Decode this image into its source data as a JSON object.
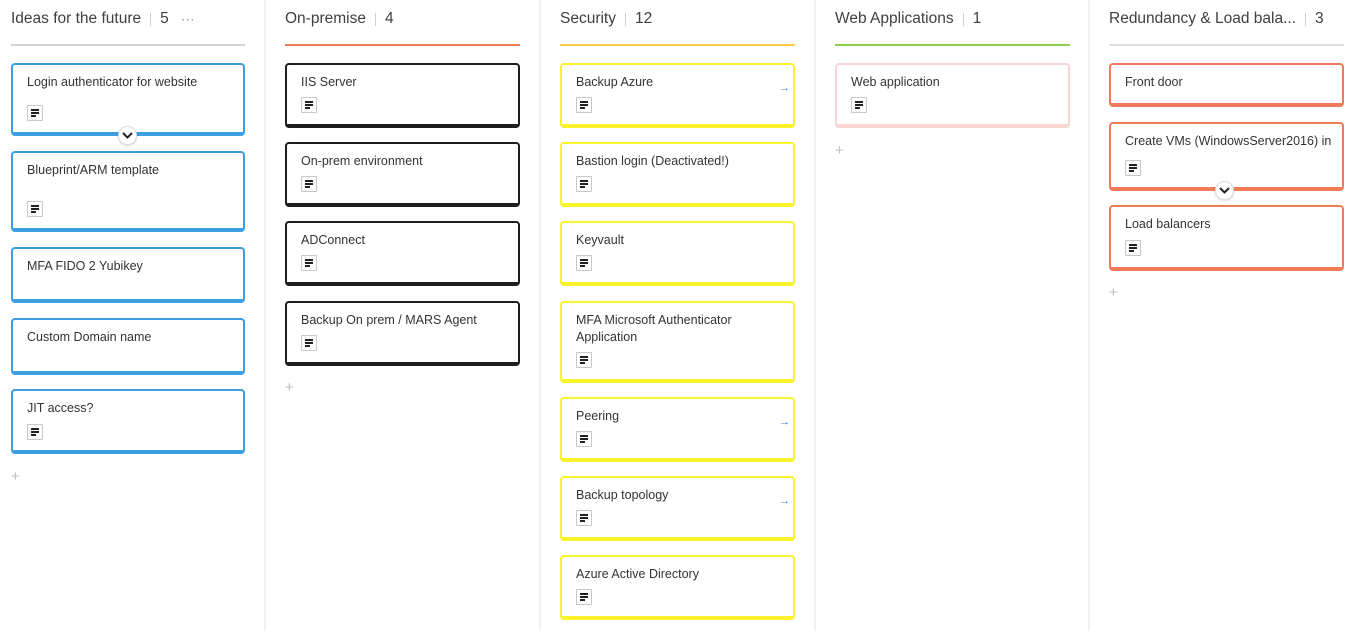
{
  "columns": [
    {
      "title": "Ideas for the future",
      "count": "5",
      "more": "⋯",
      "accent": "#3b9ee0",
      "cards": [
        {
          "title": "Login authenticator for website",
          "has_note": true,
          "has_expand": true,
          "has_link": false
        },
        {
          "title": "Blueprint/ARM template",
          "has_note": true,
          "has_expand": false,
          "has_link": false
        },
        {
          "title": "MFA FIDO 2 Yubikey",
          "has_note": false,
          "has_expand": false,
          "has_link": false
        },
        {
          "title": "Custom Domain name",
          "has_note": false,
          "has_expand": false,
          "has_link": false
        },
        {
          "title": "JIT access?",
          "has_note": true,
          "has_expand": false,
          "has_link": false
        }
      ],
      "add_label": "+"
    },
    {
      "title": "On-premise",
      "count": "4",
      "accent": "#f07b58",
      "card_border": "#1e1e1e",
      "cards": [
        {
          "title": "IIS Server",
          "has_note": true
        },
        {
          "title": "On-prem environment",
          "has_note": true
        },
        {
          "title": "ADConnect",
          "has_note": true
        },
        {
          "title": "Backup On prem / MARS Agent",
          "has_note": true
        }
      ],
      "add_label": "+"
    },
    {
      "title": "Security",
      "count": "12",
      "accent": "#f5cc3f",
      "card_border": "#f8f32b",
      "cards": [
        {
          "title": "Backup Azure",
          "has_note": true,
          "has_link": true
        },
        {
          "title": "Bastion login (Deactivated!)",
          "has_note": true,
          "has_link": false
        },
        {
          "title": "Keyvault",
          "has_note": true,
          "has_link": false
        },
        {
          "title": "MFA Microsoft Authenticator Application",
          "has_note": true,
          "has_link": false
        },
        {
          "title": "Peering",
          "has_note": true,
          "has_link": true
        },
        {
          "title": "Backup topology",
          "has_note": true,
          "has_link": true
        },
        {
          "title": "Azure Active Directory",
          "has_note": true,
          "has_link": false
        }
      ]
    },
    {
      "title": "Web Applications",
      "count": "1",
      "accent": "#8fd14f",
      "card_border": "#f6d5d3",
      "cards": [
        {
          "title": "Web application",
          "has_note": true
        }
      ],
      "add_label": "+"
    },
    {
      "title": "Redundancy & Load bala...",
      "count": "3",
      "accent": "#e0e0e0",
      "card_border": "#f07b58",
      "cards": [
        {
          "title": "Front door",
          "has_note": false,
          "has_expand": false
        },
        {
          "title": "Create VMs (WindowsServer2016) in",
          "has_note": true,
          "has_expand": true
        },
        {
          "title": "Load balancers",
          "has_note": true,
          "has_expand": false
        }
      ],
      "add_label": "+"
    }
  ],
  "icons": {
    "note": "note-lines-icon",
    "link": "arrow-right-icon",
    "expand": "chevron-down-icon",
    "more": "more-horizontal-icon",
    "add": "plus-icon"
  }
}
